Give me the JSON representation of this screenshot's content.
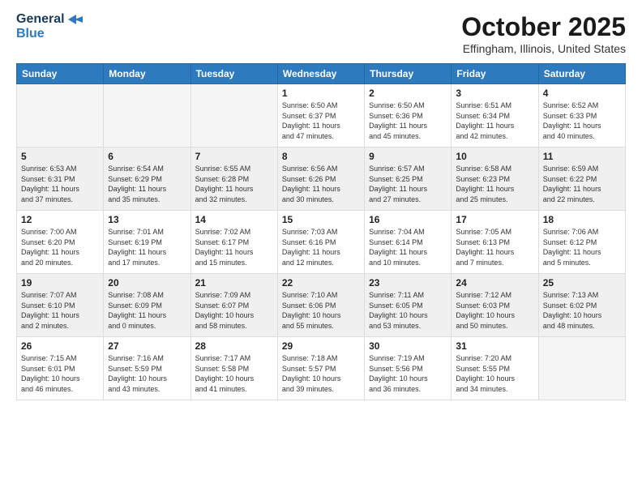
{
  "header": {
    "logo_line1": "General",
    "logo_line2": "Blue",
    "month": "October 2025",
    "location": "Effingham, Illinois, United States"
  },
  "days_of_week": [
    "Sunday",
    "Monday",
    "Tuesday",
    "Wednesday",
    "Thursday",
    "Friday",
    "Saturday"
  ],
  "weeks": [
    [
      {
        "day": "",
        "info": ""
      },
      {
        "day": "",
        "info": ""
      },
      {
        "day": "",
        "info": ""
      },
      {
        "day": "1",
        "info": "Sunrise: 6:50 AM\nSunset: 6:37 PM\nDaylight: 11 hours\nand 47 minutes."
      },
      {
        "day": "2",
        "info": "Sunrise: 6:50 AM\nSunset: 6:36 PM\nDaylight: 11 hours\nand 45 minutes."
      },
      {
        "day": "3",
        "info": "Sunrise: 6:51 AM\nSunset: 6:34 PM\nDaylight: 11 hours\nand 42 minutes."
      },
      {
        "day": "4",
        "info": "Sunrise: 6:52 AM\nSunset: 6:33 PM\nDaylight: 11 hours\nand 40 minutes."
      }
    ],
    [
      {
        "day": "5",
        "info": "Sunrise: 6:53 AM\nSunset: 6:31 PM\nDaylight: 11 hours\nand 37 minutes."
      },
      {
        "day": "6",
        "info": "Sunrise: 6:54 AM\nSunset: 6:29 PM\nDaylight: 11 hours\nand 35 minutes."
      },
      {
        "day": "7",
        "info": "Sunrise: 6:55 AM\nSunset: 6:28 PM\nDaylight: 11 hours\nand 32 minutes."
      },
      {
        "day": "8",
        "info": "Sunrise: 6:56 AM\nSunset: 6:26 PM\nDaylight: 11 hours\nand 30 minutes."
      },
      {
        "day": "9",
        "info": "Sunrise: 6:57 AM\nSunset: 6:25 PM\nDaylight: 11 hours\nand 27 minutes."
      },
      {
        "day": "10",
        "info": "Sunrise: 6:58 AM\nSunset: 6:23 PM\nDaylight: 11 hours\nand 25 minutes."
      },
      {
        "day": "11",
        "info": "Sunrise: 6:59 AM\nSunset: 6:22 PM\nDaylight: 11 hours\nand 22 minutes."
      }
    ],
    [
      {
        "day": "12",
        "info": "Sunrise: 7:00 AM\nSunset: 6:20 PM\nDaylight: 11 hours\nand 20 minutes."
      },
      {
        "day": "13",
        "info": "Sunrise: 7:01 AM\nSunset: 6:19 PM\nDaylight: 11 hours\nand 17 minutes."
      },
      {
        "day": "14",
        "info": "Sunrise: 7:02 AM\nSunset: 6:17 PM\nDaylight: 11 hours\nand 15 minutes."
      },
      {
        "day": "15",
        "info": "Sunrise: 7:03 AM\nSunset: 6:16 PM\nDaylight: 11 hours\nand 12 minutes."
      },
      {
        "day": "16",
        "info": "Sunrise: 7:04 AM\nSunset: 6:14 PM\nDaylight: 11 hours\nand 10 minutes."
      },
      {
        "day": "17",
        "info": "Sunrise: 7:05 AM\nSunset: 6:13 PM\nDaylight: 11 hours\nand 7 minutes."
      },
      {
        "day": "18",
        "info": "Sunrise: 7:06 AM\nSunset: 6:12 PM\nDaylight: 11 hours\nand 5 minutes."
      }
    ],
    [
      {
        "day": "19",
        "info": "Sunrise: 7:07 AM\nSunset: 6:10 PM\nDaylight: 11 hours\nand 2 minutes."
      },
      {
        "day": "20",
        "info": "Sunrise: 7:08 AM\nSunset: 6:09 PM\nDaylight: 11 hours\nand 0 minutes."
      },
      {
        "day": "21",
        "info": "Sunrise: 7:09 AM\nSunset: 6:07 PM\nDaylight: 10 hours\nand 58 minutes."
      },
      {
        "day": "22",
        "info": "Sunrise: 7:10 AM\nSunset: 6:06 PM\nDaylight: 10 hours\nand 55 minutes."
      },
      {
        "day": "23",
        "info": "Sunrise: 7:11 AM\nSunset: 6:05 PM\nDaylight: 10 hours\nand 53 minutes."
      },
      {
        "day": "24",
        "info": "Sunrise: 7:12 AM\nSunset: 6:03 PM\nDaylight: 10 hours\nand 50 minutes."
      },
      {
        "day": "25",
        "info": "Sunrise: 7:13 AM\nSunset: 6:02 PM\nDaylight: 10 hours\nand 48 minutes."
      }
    ],
    [
      {
        "day": "26",
        "info": "Sunrise: 7:15 AM\nSunset: 6:01 PM\nDaylight: 10 hours\nand 46 minutes."
      },
      {
        "day": "27",
        "info": "Sunrise: 7:16 AM\nSunset: 5:59 PM\nDaylight: 10 hours\nand 43 minutes."
      },
      {
        "day": "28",
        "info": "Sunrise: 7:17 AM\nSunset: 5:58 PM\nDaylight: 10 hours\nand 41 minutes."
      },
      {
        "day": "29",
        "info": "Sunrise: 7:18 AM\nSunset: 5:57 PM\nDaylight: 10 hours\nand 39 minutes."
      },
      {
        "day": "30",
        "info": "Sunrise: 7:19 AM\nSunset: 5:56 PM\nDaylight: 10 hours\nand 36 minutes."
      },
      {
        "day": "31",
        "info": "Sunrise: 7:20 AM\nSunset: 5:55 PM\nDaylight: 10 hours\nand 34 minutes."
      },
      {
        "day": "",
        "info": ""
      }
    ]
  ]
}
